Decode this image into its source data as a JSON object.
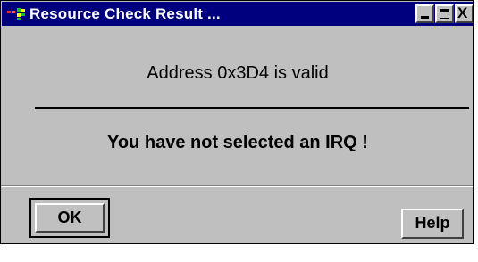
{
  "window": {
    "title": "Resource Check Result ...",
    "titlebar_color": "#00007f",
    "face_color": "#bfbfbf",
    "close_glyph": "X"
  },
  "icons": [
    "app-icon",
    "minimize-icon",
    "maximize-icon",
    "close-icon"
  ],
  "messages": {
    "address": "Address 0x3D4 is valid",
    "irq": "You have not selected an IRQ !"
  },
  "buttons": {
    "ok": "OK",
    "help": "Help"
  }
}
